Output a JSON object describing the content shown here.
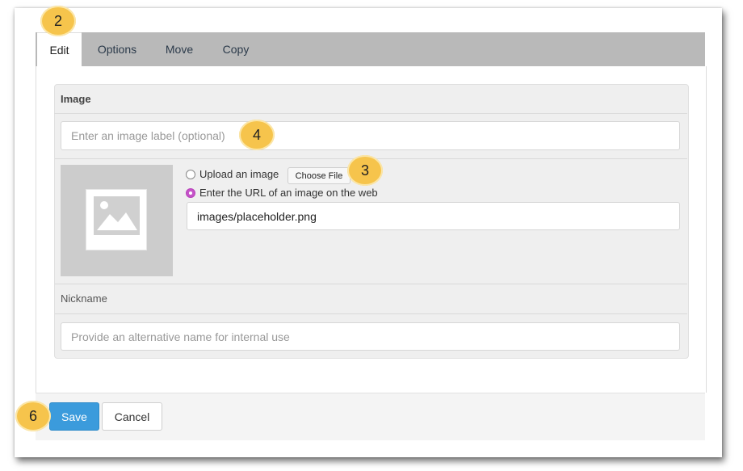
{
  "tabs": [
    {
      "label": "Edit",
      "active": true
    },
    {
      "label": "Options",
      "active": false
    },
    {
      "label": "Move",
      "active": false
    },
    {
      "label": "Copy",
      "active": false
    }
  ],
  "image_section": {
    "title": "Image",
    "label_placeholder": "Enter an image label (optional)",
    "upload_option_label": "Upload an image",
    "choose_file_label": "Choose File",
    "url_option_label": "Enter the URL of an image on the web",
    "url_value": "images/placeholder.png",
    "selected_option": "url",
    "thumbnail_icon": "image-placeholder-icon"
  },
  "nickname_section": {
    "title": "Nickname",
    "placeholder": "Provide an alternative name for internal use"
  },
  "footer": {
    "save_label": "Save",
    "cancel_label": "Cancel"
  },
  "callouts": [
    "2",
    "4",
    "3",
    "6"
  ],
  "colors": {
    "tab_bar": "#b9b9b9",
    "save_button": "#3b9bdc",
    "radio_checked": "#c554c8",
    "callout": "#f6c44c"
  }
}
